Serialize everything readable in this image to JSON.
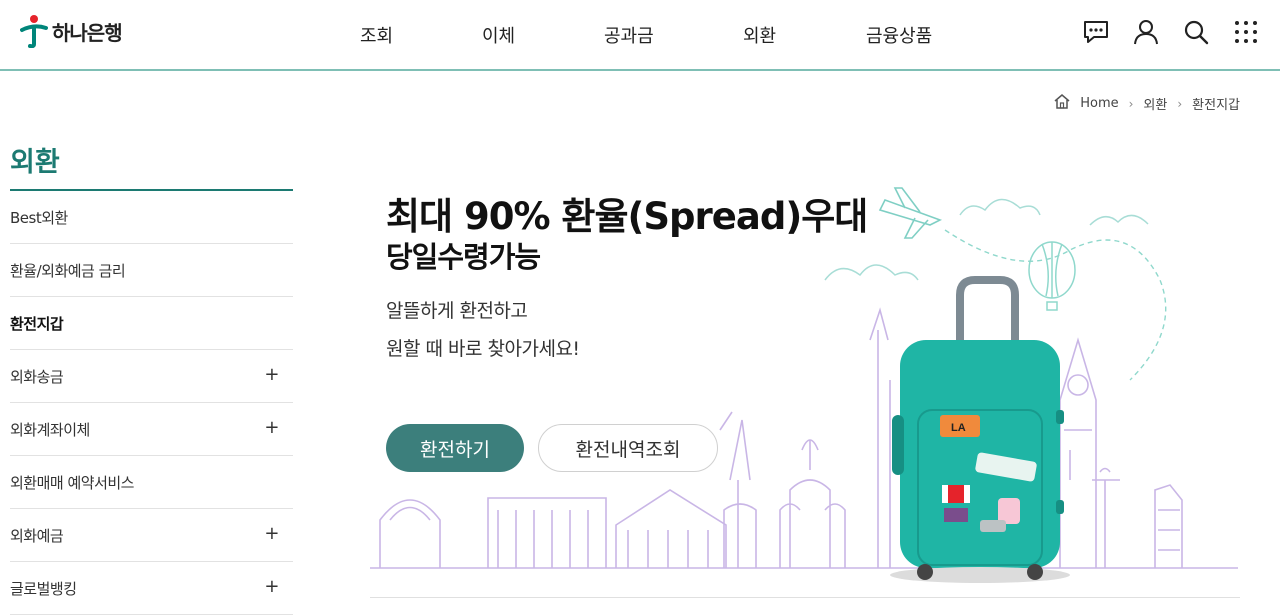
{
  "header": {
    "logo_text": "하나은행",
    "nav": [
      {
        "label": "조회"
      },
      {
        "label": "이체"
      },
      {
        "label": "공과금"
      },
      {
        "label": "외환"
      },
      {
        "label": "금융상품"
      }
    ],
    "icons": [
      "chat-icon",
      "user-icon",
      "search-icon",
      "grid-menu-icon"
    ]
  },
  "breadcrumb": {
    "home": "Home",
    "level1": "외환",
    "level2": "환전지갑"
  },
  "sidebar": {
    "title": "외환",
    "items": [
      {
        "label": "Best외환",
        "expandable": false
      },
      {
        "label": "환율/외화예금 금리",
        "expandable": false
      },
      {
        "label": "환전지갑",
        "expandable": false,
        "active": true
      },
      {
        "label": "외화송금",
        "expandable": true
      },
      {
        "label": "외화계좌이체",
        "expandable": true
      },
      {
        "label": "외환매매 예약서비스",
        "expandable": false
      },
      {
        "label": "외화예금",
        "expandable": true
      },
      {
        "label": "글로벌뱅킹",
        "expandable": true
      }
    ],
    "expand_symbol": "+"
  },
  "hero": {
    "title": "최대 90% 환율(Spread)우대",
    "subtitle": "당일수령가능",
    "desc_line1": "알뜰하게 환전하고",
    "desc_line2": "원할 때 바로 찾아가세요!",
    "primary_button": "환전하기",
    "secondary_button": "환전내역조회",
    "sticker_label": "LA"
  },
  "colors": {
    "brand": "#1c7a72",
    "primary_button": "#3c7f7c",
    "suitcase": "#1fb5a5",
    "landmark_line": "#c9b6e6"
  }
}
